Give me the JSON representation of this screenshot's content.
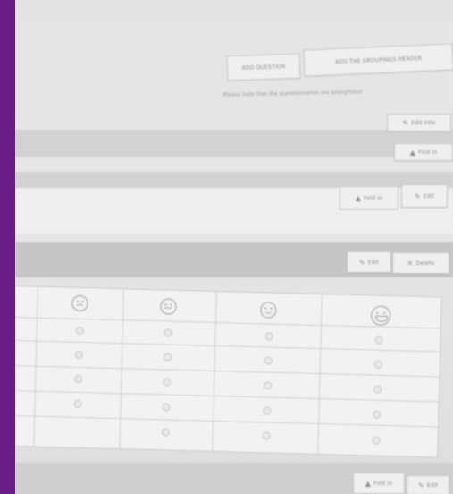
{
  "toolbar": {
    "add_question_label": "ADD QUESTION",
    "add_grouping_header_label": "ADD THE GROUPINGS HEADER"
  },
  "notice": {
    "text": "Please note that the questionnaires are anonymous"
  },
  "section_1": {
    "edit_label": "Edit title",
    "fold_in_label": "Fold in"
  },
  "section_2": {
    "fold_in_label": "Fold in",
    "edit_label": "Edit"
  },
  "question_block": {
    "edit_label": "Edit",
    "delete_label": "Delete"
  },
  "rating_scale": {
    "columns": [
      "very-unhappy",
      "neutral",
      "happy",
      "very-happy"
    ],
    "rows": 5
  },
  "bottom_bar": {
    "fold_in_label": "Fold in",
    "edit_label": "Edit"
  },
  "colors": {
    "accent": "#6a1f88"
  }
}
